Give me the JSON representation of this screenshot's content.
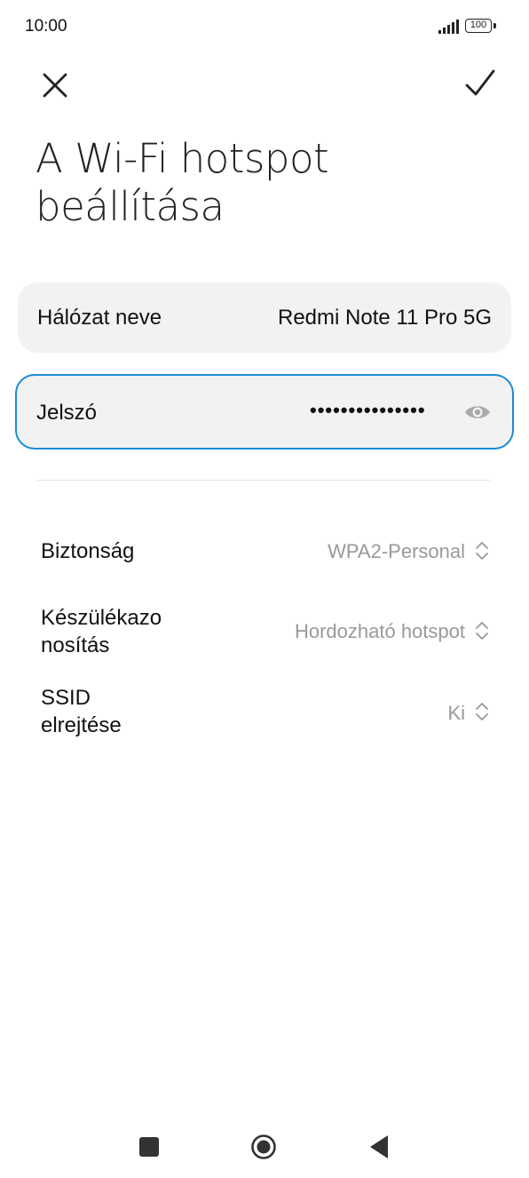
{
  "status_bar": {
    "time": "10:00",
    "battery": "100"
  },
  "toolbar": {
    "close_icon": "close-icon",
    "confirm_icon": "checkmark-icon"
  },
  "title": "A Wi-Fi hotspot beállítása",
  "network": {
    "label": "Hálózat neve",
    "value": "Redmi Note 11 Pro 5G"
  },
  "password": {
    "label": "Jelszó",
    "value": "•••••••••••••••",
    "icon": "eye-icon"
  },
  "settings": [
    {
      "label": "Biztonság",
      "value": "WPA2-Personal"
    },
    {
      "label": "Készülékazo nosítás",
      "value": "Hordozható hotspot"
    },
    {
      "label": "SSID elrejtése",
      "value": "Ki"
    }
  ],
  "colors": {
    "accent": "#1a8cd8",
    "row_background": "#f2f2f2",
    "secondary_text": "#999999"
  },
  "nav": {
    "recents_icon": "square-icon",
    "home_icon": "circle-icon",
    "back_icon": "triangle-back-icon"
  }
}
